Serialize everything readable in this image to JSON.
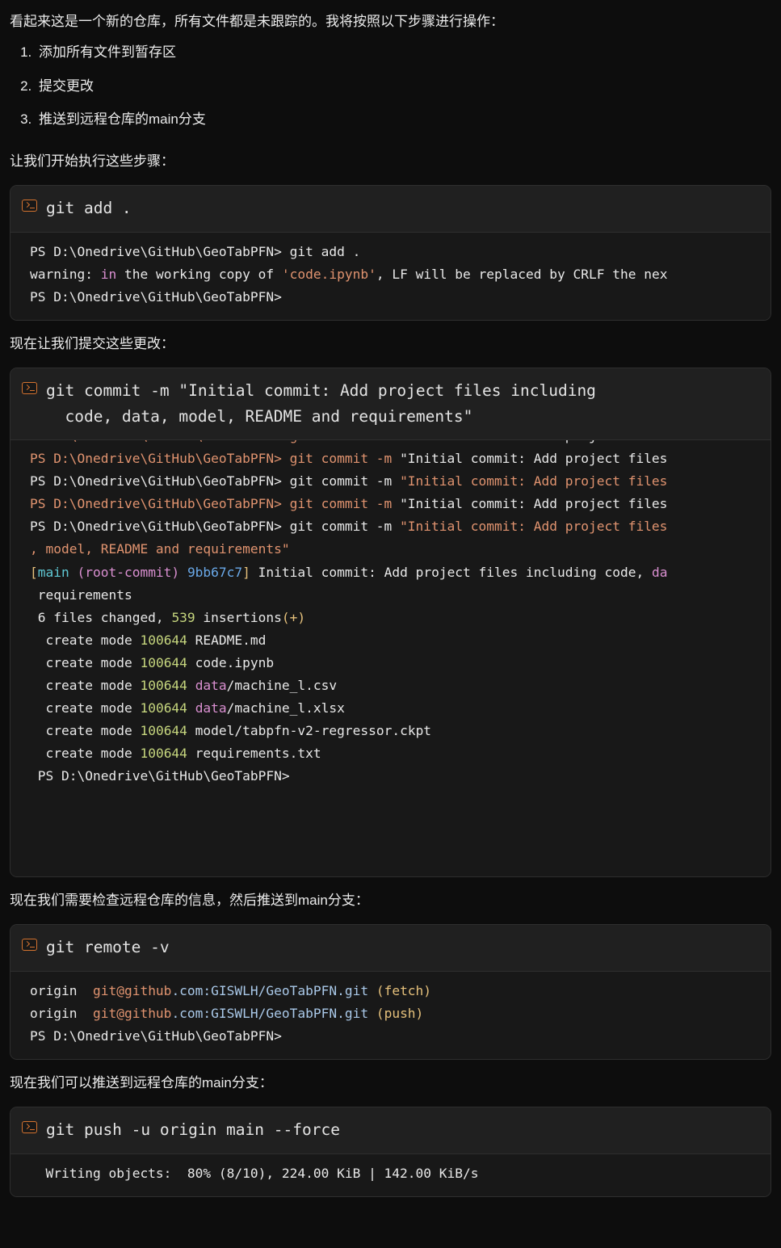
{
  "intro": {
    "paragraph": "看起来这是一个新的仓库，所有文件都是未跟踪的。我将按照以下步骤进行操作：",
    "steps": [
      "添加所有文件到暂存区",
      "提交更改",
      "推送到远程仓库的main分支"
    ],
    "lead": "让我们开始执行这些步骤："
  },
  "colors": {
    "page_bg": "#0d0d0d",
    "card_bg": "#181818",
    "card_header_bg": "#202020",
    "card_border": "#2e2e2e",
    "icon_accent": "#d4732f",
    "salmon": "#e0936f",
    "yellow": "#e5c07b",
    "green": "#c6d67e",
    "cyan": "#5fc8d4",
    "blue": "#6aa9e9",
    "pink": "#d98fd0"
  },
  "icons": {
    "terminal": "terminal-icon"
  },
  "blocks": [
    {
      "id": "git-add",
      "command": "git add .",
      "command_lines": [
        "git add ."
      ],
      "output": [
        [
          {
            "t": "PS D:\\Onedrive\\GitHub\\GeoTabPFN> ",
            "c": "c-white"
          },
          {
            "t": "git add .",
            "c": "c-white"
          }
        ],
        [
          {
            "t": "warning: ",
            "c": "c-white"
          },
          {
            "t": "in",
            "c": "c-pink"
          },
          {
            "t": " the working copy of ",
            "c": "c-white"
          },
          {
            "t": "'code.ipynb'",
            "c": "c-salmon"
          },
          {
            "t": ", LF will be replaced by CRLF the nex",
            "c": "c-white"
          }
        ],
        [
          {
            "t": "PS D:\\Onedrive\\GitHub\\GeoTabPFN>",
            "c": "c-white"
          }
        ]
      ],
      "pad_bottom": false
    },
    {
      "id": "git-commit",
      "command": "git commit -m \"Initial commit: Add project files including code, data, model, README and requirements\"",
      "command_lines": [
        "git commit -m \"Initial commit: Add project files including",
        "code, data, model, README and requirements\""
      ],
      "clipped_line": [
        {
          "t": "PS D:\\Onedrive\\GitHub\\GeoTabPFN> ",
          "c": "c-salmon"
        },
        {
          "t": "git commit -m ",
          "c": "c-salmon"
        },
        {
          "t": "\"Initial commit: Add project files",
          "c": "c-white"
        }
      ],
      "output": [
        [
          {
            "t": "PS D:\\Onedrive\\GitHub\\GeoTabPFN> ",
            "c": "c-salmon"
          },
          {
            "t": "git commit -m ",
            "c": "c-salmon"
          },
          {
            "t": "\"Initial ",
            "c": "c-white"
          },
          {
            "t": "commit: ",
            "c": "c-white"
          },
          {
            "t": "Add project files",
            "c": "c-white"
          }
        ],
        [
          {
            "t": "PS D:\\Onedrive\\GitHub\\GeoTabPFN> ",
            "c": "c-white"
          },
          {
            "t": "git commit -m ",
            "c": "c-white"
          },
          {
            "t": "\"Initial ",
            "c": "c-salmon"
          },
          {
            "t": "commit: ",
            "c": "c-salmon"
          },
          {
            "t": "Add project files",
            "c": "c-salmon"
          }
        ],
        [
          {
            "t": "PS D:\\Onedrive\\GitHub\\GeoTabPFN> ",
            "c": "c-salmon"
          },
          {
            "t": "git commit -m ",
            "c": "c-salmon"
          },
          {
            "t": "\"Initial ",
            "c": "c-white"
          },
          {
            "t": "commit: ",
            "c": "c-white"
          },
          {
            "t": "Add project files",
            "c": "c-white"
          }
        ],
        [
          {
            "t": "PS D:\\Onedrive\\GitHub\\GeoTabPFN> ",
            "c": "c-white"
          },
          {
            "t": "git commit -m ",
            "c": "c-white"
          },
          {
            "t": "\"Initial ",
            "c": "c-salmon"
          },
          {
            "t": "commit: ",
            "c": "c-salmon"
          },
          {
            "t": "Add project files",
            "c": "c-salmon"
          }
        ],
        [
          {
            "t": ", model, README and requirements\"",
            "c": "c-salmon"
          }
        ],
        [
          {
            "t": "[",
            "c": "c-yellow"
          },
          {
            "t": "main",
            "c": "c-cyan"
          },
          {
            "t": " (root-commit)",
            "c": "c-pink"
          },
          {
            "t": " ",
            "c": "c-white"
          },
          {
            "t": "9bb67c7",
            "c": "c-blue"
          },
          {
            "t": "]",
            "c": "c-yellow"
          },
          {
            "t": " Initial commit: Add project files including code, ",
            "c": "c-white"
          },
          {
            "t": "da",
            "c": "c-pink"
          }
        ],
        [
          {
            "t": " requirements",
            "c": "c-white"
          }
        ],
        [
          {
            "t": " 6 files changed, ",
            "c": "c-white"
          },
          {
            "t": "539",
            "c": "c-green"
          },
          {
            "t": " insertions",
            "c": "c-white"
          },
          {
            "t": "(+)",
            "c": "c-yellow"
          }
        ],
        [
          {
            "t": "  create mode ",
            "c": "c-white"
          },
          {
            "t": "100644",
            "c": "c-green"
          },
          {
            "t": " README.md",
            "c": "c-white"
          }
        ],
        [
          {
            "t": "  create mode ",
            "c": "c-white"
          },
          {
            "t": "100644",
            "c": "c-green"
          },
          {
            "t": " code.ipynb",
            "c": "c-white"
          }
        ],
        [
          {
            "t": "  create mode ",
            "c": "c-white"
          },
          {
            "t": "100644",
            "c": "c-green"
          },
          {
            "t": " ",
            "c": "c-white"
          },
          {
            "t": "data",
            "c": "c-pink"
          },
          {
            "t": "/machine_l.csv",
            "c": "c-white"
          }
        ],
        [
          {
            "t": "  create mode ",
            "c": "c-white"
          },
          {
            "t": "100644",
            "c": "c-green"
          },
          {
            "t": " ",
            "c": "c-white"
          },
          {
            "t": "data",
            "c": "c-pink"
          },
          {
            "t": "/machine_l.xlsx",
            "c": "c-white"
          }
        ],
        [
          {
            "t": "  create mode ",
            "c": "c-white"
          },
          {
            "t": "100644",
            "c": "c-green"
          },
          {
            "t": " model/tabpfn-v2-regressor.ckpt",
            "c": "c-white"
          }
        ],
        [
          {
            "t": "  create mode ",
            "c": "c-white"
          },
          {
            "t": "100644",
            "c": "c-green"
          },
          {
            "t": " requirements.txt",
            "c": "c-white"
          }
        ],
        [
          {
            "t": " PS D:\\Onedrive\\GitHub\\GeoTabPFN>",
            "c": "c-white"
          }
        ]
      ],
      "pad_bottom": true
    },
    {
      "id": "git-remote",
      "command": "git remote -v",
      "command_lines": [
        "git remote -v"
      ],
      "output": [
        [
          {
            "t": "origin  ",
            "c": "c-white"
          },
          {
            "t": "git@github",
            "c": "c-salmon"
          },
          {
            "t": ".com:GISWLH/GeoTabPFN.git ",
            "c": "c-lblue"
          },
          {
            "t": "(fetch)",
            "c": "c-yellow"
          }
        ],
        [
          {
            "t": "origin  ",
            "c": "c-white"
          },
          {
            "t": "git@github",
            "c": "c-salmon"
          },
          {
            "t": ".com:GISWLH/GeoTabPFN.git ",
            "c": "c-lblue"
          },
          {
            "t": "(push)",
            "c": "c-yellow"
          }
        ],
        [
          {
            "t": "PS D:\\Onedrive\\GitHub\\GeoTabPFN>",
            "c": "c-white"
          }
        ]
      ],
      "pad_bottom": false
    },
    {
      "id": "git-push",
      "command": "git push -u origin main --force",
      "command_lines": [
        "git push -u origin main --force"
      ],
      "output": [
        [
          {
            "t": "  Writing objects:  80% (8/10), 224.00 KiB | 142.00 KiB/s",
            "c": "c-white"
          }
        ]
      ],
      "pad_bottom": false
    }
  ],
  "between": {
    "after_add": "现在让我们提交这些更改：",
    "after_commit": "现在我们需要检查远程仓库的信息，然后推送到main分支：",
    "after_remote": "现在我们可以推送到远程仓库的main分支："
  }
}
